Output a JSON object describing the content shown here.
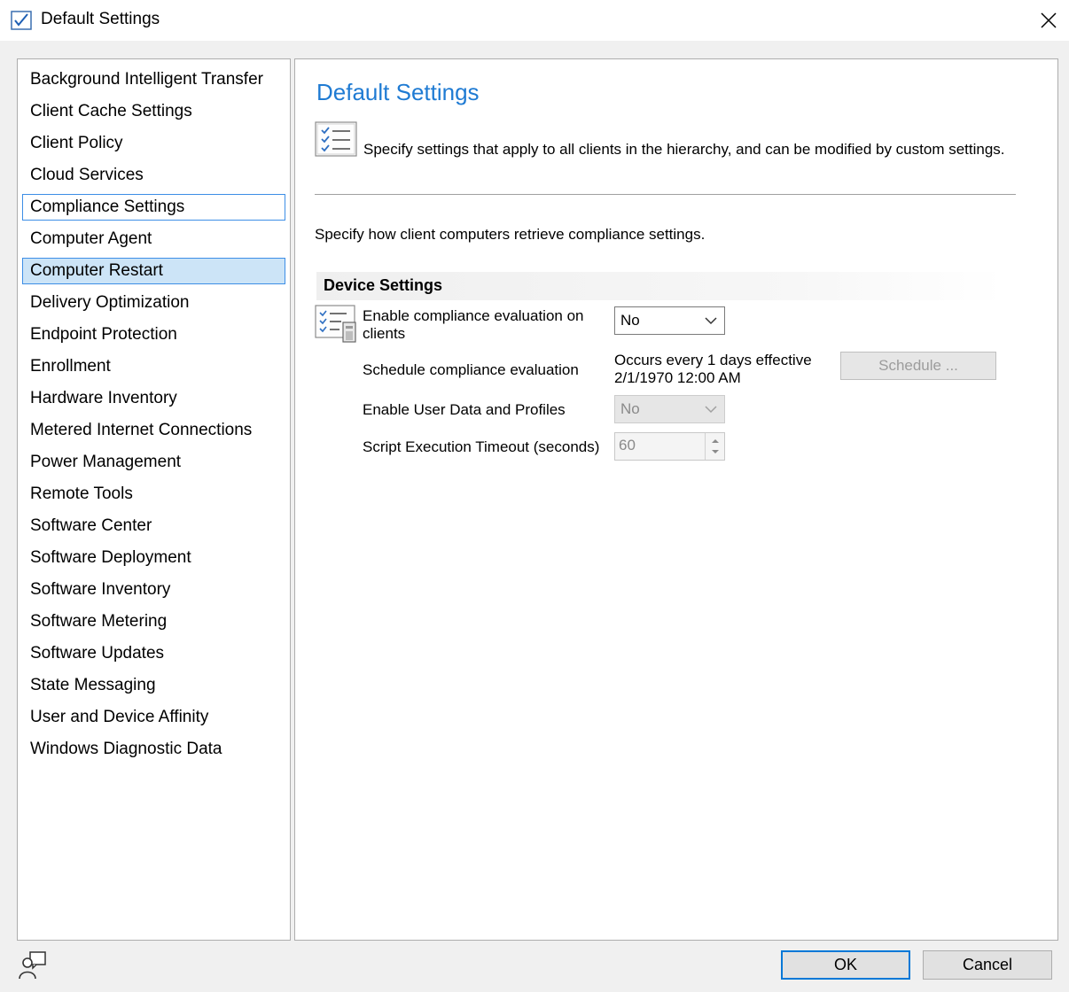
{
  "window": {
    "title": "Default Settings"
  },
  "nav": {
    "items": [
      {
        "label": "Background Intelligent Transfer"
      },
      {
        "label": "Client Cache Settings"
      },
      {
        "label": "Client Policy"
      },
      {
        "label": "Cloud Services"
      },
      {
        "label": "Compliance Settings"
      },
      {
        "label": "Computer Agent"
      },
      {
        "label": "Computer Restart"
      },
      {
        "label": "Delivery Optimization"
      },
      {
        "label": "Endpoint Protection"
      },
      {
        "label": "Enrollment"
      },
      {
        "label": "Hardware Inventory"
      },
      {
        "label": "Metered Internet Connections"
      },
      {
        "label": "Power Management"
      },
      {
        "label": "Remote Tools"
      },
      {
        "label": "Software Center"
      },
      {
        "label": "Software Deployment"
      },
      {
        "label": "Software Inventory"
      },
      {
        "label": "Software Metering"
      },
      {
        "label": "Software Updates"
      },
      {
        "label": "State Messaging"
      },
      {
        "label": "User and Device Affinity"
      },
      {
        "label": "Windows Diagnostic Data"
      }
    ]
  },
  "panel": {
    "title": "Default Settings",
    "description": "Specify settings that apply to all clients in the hierarchy, and can be modified by custom settings.",
    "section_description": "Specify how client computers retrieve compliance settings.",
    "group_title": "Device Settings",
    "settings": {
      "enable_eval": {
        "label_line1": "Enable compliance evaluation on",
        "label_line2": "clients",
        "value": "No"
      },
      "schedule": {
        "label": "Schedule compliance evaluation",
        "value_line1": "Occurs every 1 days effective",
        "value_line2": "2/1/1970 12:00 AM",
        "button": "Schedule ..."
      },
      "user_data": {
        "label": "Enable User Data and Profiles",
        "value": "No"
      },
      "timeout": {
        "label": "Script Execution Timeout (seconds)",
        "value": "60"
      }
    }
  },
  "buttons": {
    "ok": "OK",
    "cancel": "Cancel"
  },
  "colors": {
    "accent": "#1f7bd3",
    "selection": "#cce4f7",
    "focus_border": "#3d8ee6"
  }
}
